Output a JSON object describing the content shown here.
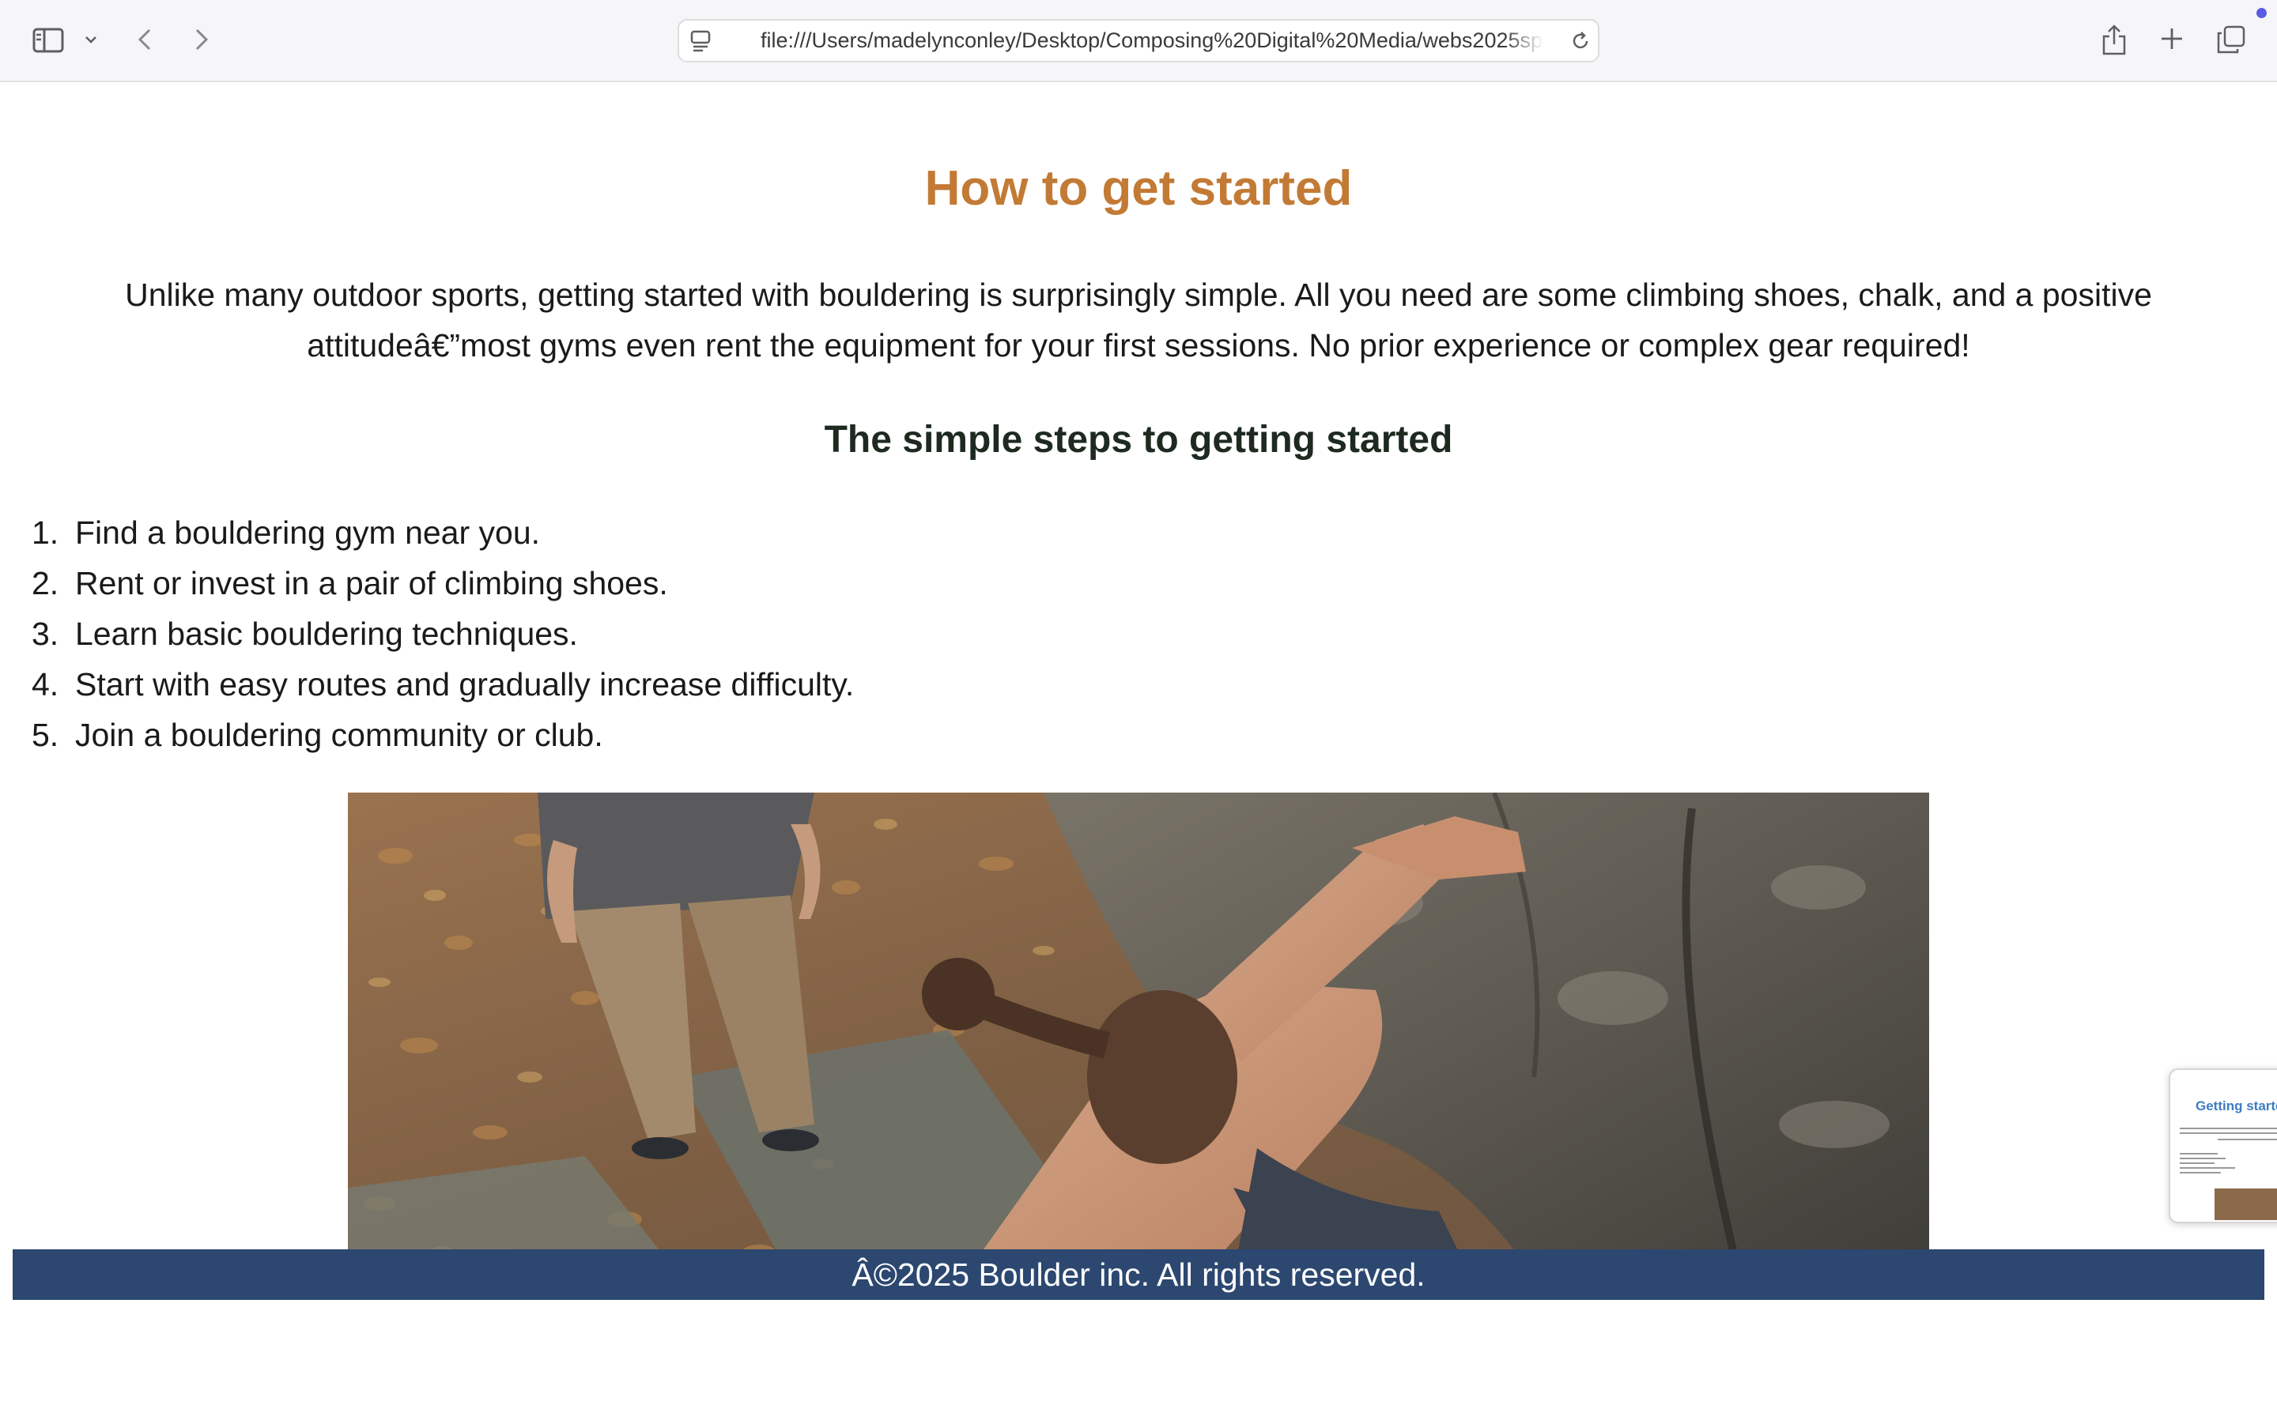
{
  "browser": {
    "url": "file:///Users/madelynconley/Desktop/Composing%20Digital%20Media/webs2025sp",
    "icons": [
      "sidebar-icon",
      "chevron-down-icon",
      "back-icon",
      "forward-icon",
      "page-menu-icon",
      "reload-icon",
      "share-icon",
      "plus-icon",
      "tabs-overview-icon"
    ]
  },
  "page": {
    "title": "How to get started",
    "intro": "Unlike many outdoor sports, getting started with bouldering is surprisingly simple. All you need are some climbing shoes, chalk, and a positive attitudeâ€”most gyms even rent the equipment for your first sessions. No prior experience or complex gear required!",
    "subtitle": "The simple steps to getting started",
    "steps": [
      {
        "num": "1.",
        "text": "Find a bouldering gym near you."
      },
      {
        "num": "2.",
        "text": "Rent or invest in a pair of climbing shoes."
      },
      {
        "num": "3.",
        "text": "Learn basic bouldering techniques."
      },
      {
        "num": "4.",
        "text": "Start with easy routes and gradually increase difficulty."
      },
      {
        "num": "5.",
        "text": "Join a bouldering community or club."
      }
    ],
    "footer": "Â©2025 Boulder inc. All rights reserved."
  },
  "thumbnail": {
    "title": "Getting started"
  },
  "colors": {
    "title": "#c27a35",
    "footer_bg": "#2c4770",
    "accent_dot": "#5b5ce6"
  }
}
